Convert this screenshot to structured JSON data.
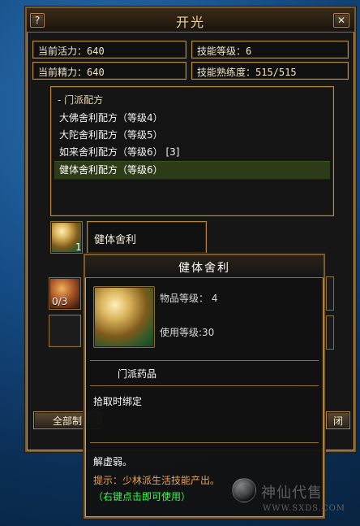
{
  "window": {
    "title": "开光",
    "help_glyph": "?",
    "close_glyph": "✕"
  },
  "stats": {
    "vitality": "当前活力：640",
    "energy": "当前精力：640",
    "skill_level": "技能等级：6",
    "proficiency": "技能熟练度：515/515"
  },
  "recipes": {
    "category": "- 门派配方",
    "items": [
      {
        "label": "大佛舍利配方（等级4）"
      },
      {
        "label": "大陀舍利配方（等级5）"
      },
      {
        "label": "如来舍利配方（等级6） [3]"
      },
      {
        "label": "健体舍利配方（等级6）"
      }
    ]
  },
  "product": {
    "name": "健体舍利",
    "count": "1"
  },
  "materials": {
    "slot1_count": "0/3"
  },
  "footer": {
    "all_make_label": "全部制",
    "close_label": "闭"
  },
  "tooltip": {
    "title": "健体舍利",
    "item_level": "物品等级： 4",
    "use_level": "使用等级:30",
    "category": "门派药品",
    "bind": "拾取时绑定",
    "desc1": "解虚弱。",
    "hint": "提示：少林派生活技能产出。",
    "action": "（右键点击即可使用）"
  },
  "watermark": {
    "site_name": "神仙代售",
    "site_url": "WWW.SXDS.COM"
  },
  "colors": {
    "gold": "#b58a3d",
    "panel_dark": "#161616",
    "selected_bg": "#2d3b18",
    "cyan_text": "#7fe6ff",
    "orange_text": "#f0a24a",
    "green_text": "#2dff4a"
  }
}
